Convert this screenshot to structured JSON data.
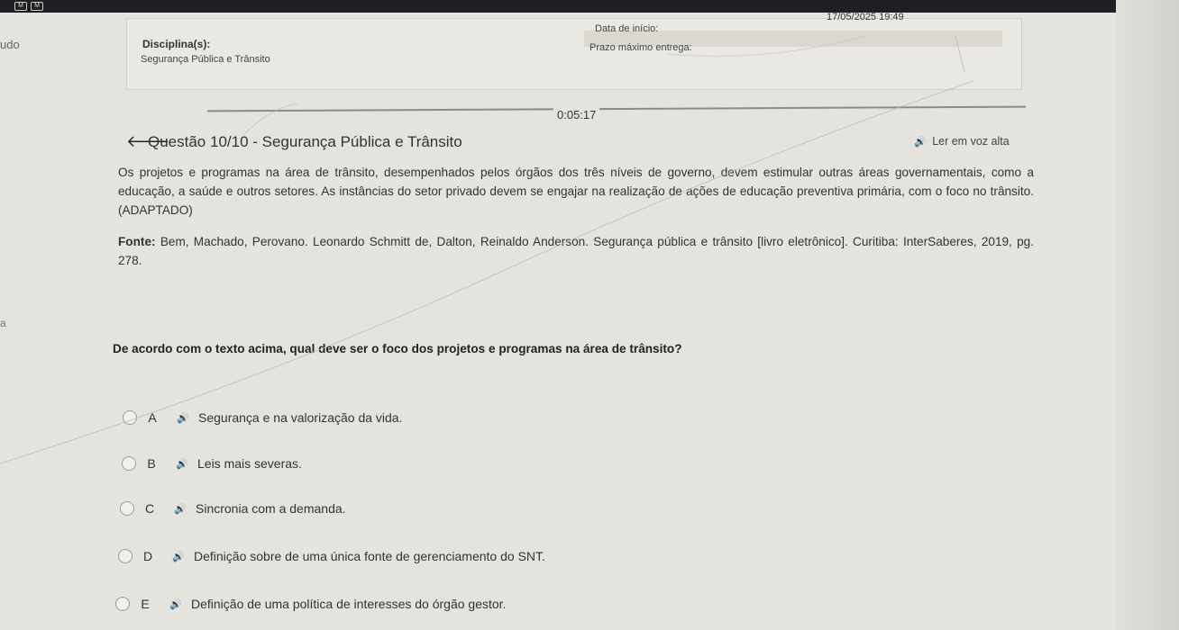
{
  "window": {
    "left_fragment": "udo",
    "left_fragment_2": "a"
  },
  "header": {
    "discipline_label": "Disciplina(s):",
    "discipline_value": "Segurança Pública e Trânsito",
    "start_label": "Data de início:",
    "start_value": "17/05/2025 19:49",
    "deadline_label": "Prazo máximo entrega:"
  },
  "timer": "0:05:17",
  "question": {
    "title": "Questão 10/10 - Segurança Pública e Trânsito",
    "listen_label": "Ler em voz alta",
    "paragraph1": "Os projetos e programas na área de trânsito, desempenhados pelos órgãos dos três níveis de governo, devem estimular outras áreas governamentais, como a educação, a saúde e outros setores. As instâncias do setor privado devem se engajar na realização de ações de educação preventiva primária, com o foco no trânsito. (ADAPTADO)",
    "paragraph2_label": "Fonte:",
    "paragraph2": "Bem, Machado, Perovano. Leonardo Schmitt de, Dalton, Reinaldo Anderson. Segurança pública e trânsito [livro eletrônico]. Curitiba: InterSaberes, 2019, pg. 278.",
    "prompt": "De acordo com o texto acima, qual deve ser o foco dos projetos e programas na área de trânsito?",
    "options": [
      {
        "letter": "A",
        "text": "Segurança e na valorização da vida."
      },
      {
        "letter": "B",
        "text": "Leis mais severas."
      },
      {
        "letter": "C",
        "text": "Sincronia com a demanda."
      },
      {
        "letter": "D",
        "text": "Definição sobre de uma única fonte de gerenciamento do SNT."
      },
      {
        "letter": "E",
        "text": "Definição de uma política de interesses do órgão gestor."
      }
    ]
  },
  "icons": {
    "speaker": "🔊",
    "back": "🡐"
  }
}
